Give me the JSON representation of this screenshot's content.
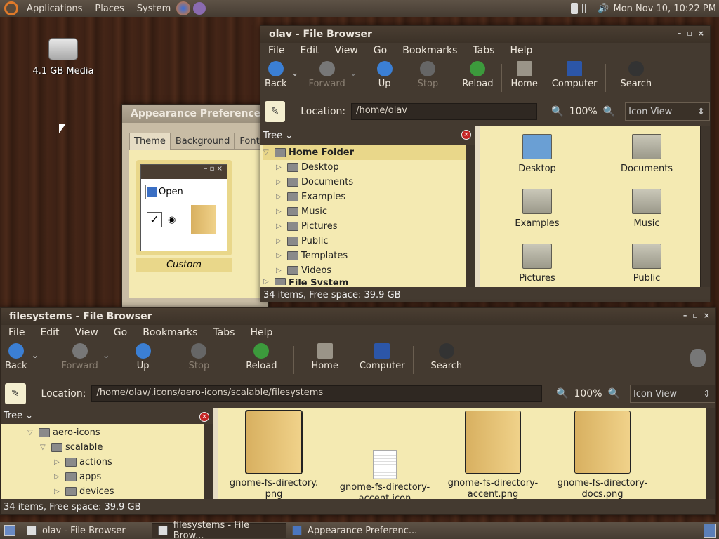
{
  "top_panel": {
    "menus": [
      "Applications",
      "Places",
      "System"
    ],
    "clock": "Mon Nov 10, 10:22 PM"
  },
  "desktop": {
    "drive_label": "4.1 GB Media"
  },
  "appearance": {
    "title": "Appearance Preferences",
    "tabs": [
      "Theme",
      "Background",
      "Fonts"
    ],
    "open_label": "Open",
    "custom_label": "Custom"
  },
  "olav": {
    "title": "olav - File Browser",
    "menus": [
      "File",
      "Edit",
      "View",
      "Go",
      "Bookmarks",
      "Tabs",
      "Help"
    ],
    "toolbar": {
      "back": "Back",
      "forward": "Forward",
      "up": "Up",
      "stop": "Stop",
      "reload": "Reload",
      "home": "Home",
      "computer": "Computer",
      "search": "Search"
    },
    "location_label": "Location:",
    "location": "/home/olav",
    "zoom": "100%",
    "view": "Icon View",
    "pane": "Tree",
    "tree": [
      "Home Folder",
      "Desktop",
      "Documents",
      "Examples",
      "Music",
      "Pictures",
      "Public",
      "Templates",
      "Videos",
      "File System"
    ],
    "icons": [
      "Desktop",
      "Documents",
      "Examples",
      "Music",
      "Pictures",
      "Public"
    ],
    "status": "34 items, Free space: 39.9 GB"
  },
  "fs": {
    "title": "filesystems - File Browser",
    "menus": [
      "File",
      "Edit",
      "View",
      "Go",
      "Bookmarks",
      "Tabs",
      "Help"
    ],
    "toolbar": {
      "back": "Back",
      "forward": "Forward",
      "up": "Up",
      "stop": "Stop",
      "reload": "Reload",
      "home": "Home",
      "computer": "Computer",
      "search": "Search"
    },
    "location_label": "Location:",
    "location": "/home/olav/.icons/aero-icons/scalable/filesystems",
    "zoom": "100%",
    "view": "Icon View",
    "pane": "Tree",
    "tree": [
      "aero-icons",
      "scalable",
      "actions",
      "apps",
      "devices"
    ],
    "icons": [
      "gnome-fs-directory.\npng",
      "gnome-fs-directory-\naccent.icon",
      "gnome-fs-directory-\naccent.png",
      "gnome-fs-directory-\ndocs.png"
    ],
    "status": "34 items, Free space: 39.9 GB"
  },
  "taskbar": [
    "olav - File Browser",
    "filesystems - File Brow...",
    "Appearance Preferenc..."
  ]
}
